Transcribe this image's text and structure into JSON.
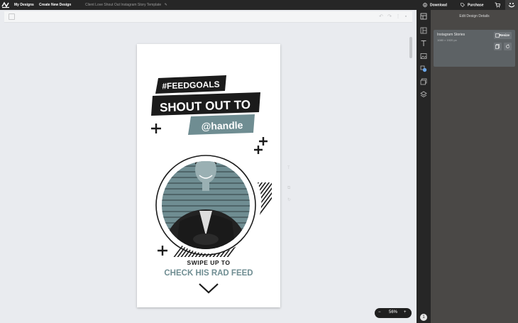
{
  "topbar": {
    "nav_my_designs": "My Designs",
    "nav_create_new": "Create New Design",
    "doc_title": "Client Love Shout Out Instagram Story Template",
    "download_label": "Download",
    "purchase_label": "Purchase"
  },
  "design": {
    "tag_text": "#FEEDGOALS",
    "headline": "SHOUT OUT TO",
    "handle": "@handle",
    "swipe_text": "SWIPE UP TO",
    "cta_text": "CHECK HIS RAD FEED",
    "colors": {
      "dark": "#1b1b1b",
      "teal": "#6f8d92"
    }
  },
  "zoom": {
    "minus": "−",
    "value": "56%",
    "plus": "+"
  },
  "panel": {
    "header": "Edit Design Details",
    "design_name": "Instagram Stories",
    "design_dims": "1080 × 1920 px",
    "resize_label": "Resize"
  },
  "rail": {
    "badge": "1",
    "icons": [
      "layout-icon",
      "templates-icon",
      "text-icon",
      "image-icon",
      "shapes-icon",
      "background-icon",
      "layers-icon"
    ]
  }
}
